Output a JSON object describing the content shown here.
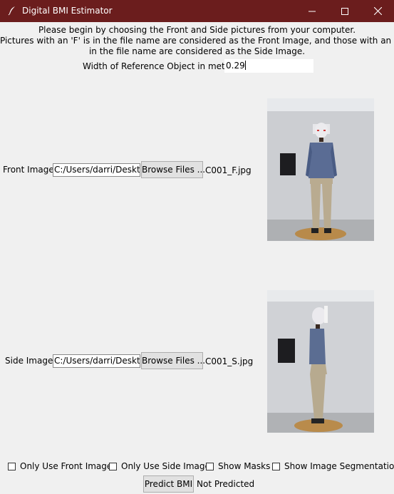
{
  "window": {
    "title": "Digital BMI Estimator",
    "app_icon": "feather-icon",
    "controls": [
      "minimize-icon",
      "maximize-icon",
      "close-icon"
    ]
  },
  "instructions": {
    "line1": "Please begin by choosing the Front and Side pictures from your computer.",
    "line2": "Pictures with an 'F' is in the file name are considered as the Front Image, and those with an 'S'",
    "line3": "in the file name are considered as the Side Image."
  },
  "reference": {
    "label": "Width of Reference Object in meters:",
    "value": "0.29"
  },
  "front": {
    "label": "Front Image:",
    "path": "C:/Users/darri/Desktop",
    "browse_label": "Browse Files ...",
    "filename": "C001_F.jpg"
  },
  "side": {
    "label": "Side Image:",
    "path": "C:/Users/darri/Desktop",
    "browse_label": "Browse Files ...",
    "filename": "C001_S.jpg"
  },
  "options": [
    {
      "label": "Only Use Front Image",
      "checked": false
    },
    {
      "label": "Only Use Side Image",
      "checked": false
    },
    {
      "label": "Show Masks",
      "checked": false
    },
    {
      "label": "Show Image Segmentation",
      "checked": false
    }
  ],
  "predict": {
    "button_label": "Predict BMI",
    "status": "Not Predicted"
  },
  "colors": {
    "titlebar": "#6b1d1d",
    "window_bg": "#f0f0f0",
    "button_bg": "#e1e1e1"
  }
}
